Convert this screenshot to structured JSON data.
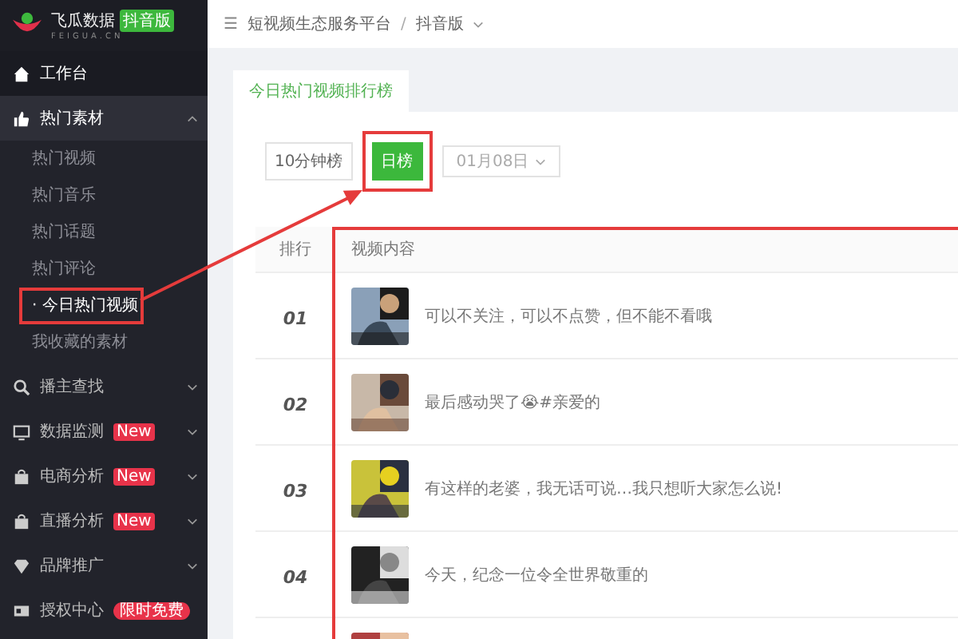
{
  "logo": {
    "name": "飞瓜数据",
    "badge": "抖音版",
    "subtitle": "FEIGUA.CN"
  },
  "breadcrumb": {
    "icon": "☰",
    "separator": "/",
    "items": [
      "短视频生态服务平台",
      "抖音版"
    ]
  },
  "sidebar": {
    "items": [
      {
        "kind": "link",
        "label": "工作台"
      },
      {
        "kind": "main",
        "label": "热门素材",
        "expanded": true,
        "children": [
          {
            "label": "热门视频",
            "selected": false,
            "highlighted": false
          },
          {
            "label": "热门音乐",
            "selected": false,
            "highlighted": false
          },
          {
            "label": "热门话题",
            "selected": false,
            "highlighted": false
          },
          {
            "label": "热门评论",
            "selected": false,
            "highlighted": false
          },
          {
            "label": "· 今日热门视频",
            "selected": true,
            "highlighted": true
          },
          {
            "label": "我收藏的素材",
            "selected": false,
            "highlighted": false
          }
        ]
      },
      {
        "kind": "main",
        "label": "播主查找",
        "expanded": false
      },
      {
        "kind": "main",
        "label": "数据监测",
        "expanded": false,
        "badge": "New"
      },
      {
        "kind": "main",
        "label": "电商分析",
        "expanded": false,
        "badge": "New"
      },
      {
        "kind": "main",
        "label": "直播分析",
        "expanded": false,
        "badge": "New"
      },
      {
        "kind": "main",
        "label": "品牌推广",
        "expanded": false
      },
      {
        "kind": "plain",
        "label": "授权中心",
        "badge": "限时免费"
      }
    ]
  },
  "tabs": [
    {
      "label": "今日热门视频排行榜",
      "selected": true
    }
  ],
  "filters": {
    "options": [
      {
        "label": "10分钟榜",
        "selected": false,
        "highlighted": false
      },
      {
        "label": "日榜",
        "selected": true,
        "highlighted": true
      }
    ],
    "date": "01月08日"
  },
  "table": {
    "columns": [
      {
        "label": "排行"
      },
      {
        "label": "视频内容",
        "highlighted": true
      }
    ],
    "rows": [
      {
        "rank": "01",
        "text": "可以不关注，可以不点赞，但不能不看哦"
      },
      {
        "rank": "02",
        "text": "最后感动哭了😭#亲爱的"
      },
      {
        "rank": "03",
        "text": "有这样的老婆，我无话可说…我只想听大家怎么说!"
      },
      {
        "rank": "04",
        "text": "今天，纪念一位令全世界敬重的"
      },
      {
        "rank": "",
        "text": ""
      }
    ]
  }
}
